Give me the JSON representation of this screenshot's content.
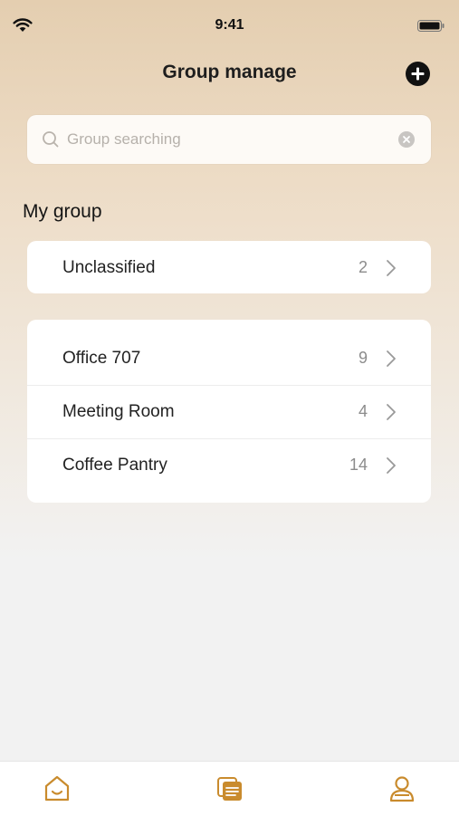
{
  "status_bar": {
    "time": "9:41",
    "wifi_icon": "wifi-icon",
    "battery_icon": "battery-icon"
  },
  "header": {
    "title": "Group manage",
    "add_icon": "plus-circle-icon"
  },
  "search": {
    "placeholder": "Group searching",
    "value": "",
    "search_icon": "search-icon",
    "clear_icon": "clear-icon"
  },
  "section": {
    "title": "My group"
  },
  "unclassified": {
    "label": "Unclassified",
    "count": "2"
  },
  "groups": [
    {
      "label": "Office 707",
      "count": "9"
    },
    {
      "label": "Meeting Room",
      "count": "4"
    },
    {
      "label": "Coffee Pantry",
      "count": "14"
    }
  ],
  "tab_bar": {
    "tabs": [
      {
        "icon": "home-icon"
      },
      {
        "icon": "list-icon"
      },
      {
        "icon": "profile-icon"
      }
    ]
  },
  "colors": {
    "accent": "#c98b2d",
    "header_bg": "#e4ceb0",
    "page_bg": "#f2f2f2",
    "count_text": "#8c8c8c"
  }
}
